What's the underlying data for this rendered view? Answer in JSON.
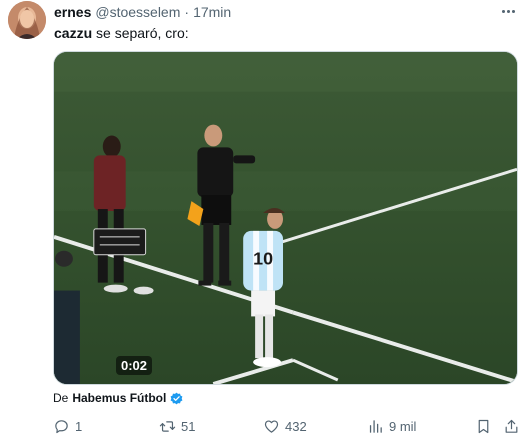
{
  "post": {
    "author": {
      "display_name": "ernes",
      "handle": "@stoesselem",
      "separator": "·",
      "time": "17min"
    },
    "text": {
      "mention": "cazzu",
      "rest": " se separó, cro:"
    },
    "media": {
      "duration": "0:02"
    },
    "source": {
      "prefix": "De",
      "account": "Habemus Fútbol",
      "verified_icon": "verified-badge-icon"
    },
    "actions": {
      "replies": "1",
      "reposts": "51",
      "likes": "432",
      "views": "9 mil"
    },
    "icons": {
      "more": "more-options-icon",
      "reply": "reply-icon",
      "repost": "repost-icon",
      "like": "heart-icon",
      "views": "views-chart-icon",
      "bookmark": "bookmark-icon",
      "share": "share-icon"
    },
    "colors": {
      "text_primary": "#0f1419",
      "text_secondary": "#536471",
      "verified": "#1d9bf0"
    }
  }
}
